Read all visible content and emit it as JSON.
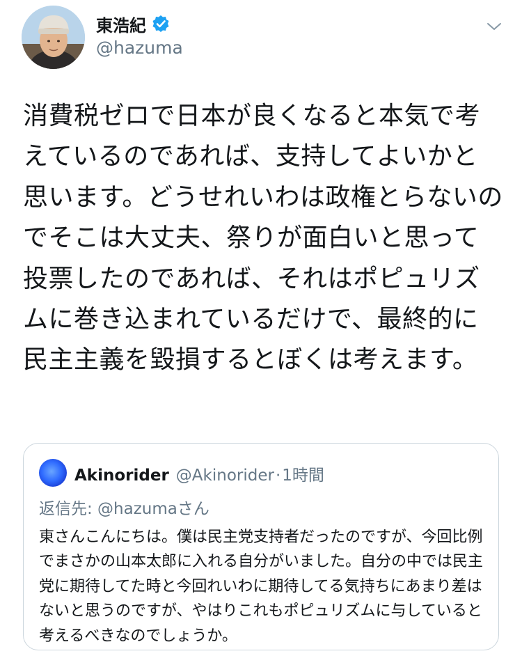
{
  "author": {
    "display_name": "東浩紀",
    "handle": "@hazuma",
    "verified_icon": "verified-badge-icon",
    "avatar": "avatar-photo"
  },
  "menu_icon": "chevron-down-icon",
  "tweet": {
    "text": "消費税ゼロで日本が良くなると本気で考えているのであれば、支持してよいかと思います。どうせれいわは政権とらないのでそこは大丈夫、祭りが面白いと思って投票したのであれば、それはポピュリズムに巻き込まれているだけで、最終的に民主主義を毀損するとぼくは考えます。"
  },
  "quoted_tweet": {
    "display_name": "Akinorider",
    "handle": "@Akinorider",
    "separator": "·",
    "time": "1時間",
    "reply_to": "返信先: @hazumaさん",
    "text": "東さんこんにちは。僕は民主党支持者だったのですが、今回比例でまさかの山本太郎に入れる自分がいました。自分の中では民主党に期待してた時と今回れいわに期待してる気持ちにあまり差はないと思うのですが、やはりこれもポピュリズムに与していると考えるべきなのでしょうか。"
  },
  "colors": {
    "text_primary": "#14171a",
    "text_secondary": "#657786",
    "verified_blue": "#1da1f2",
    "border": "#ccd6dd"
  }
}
